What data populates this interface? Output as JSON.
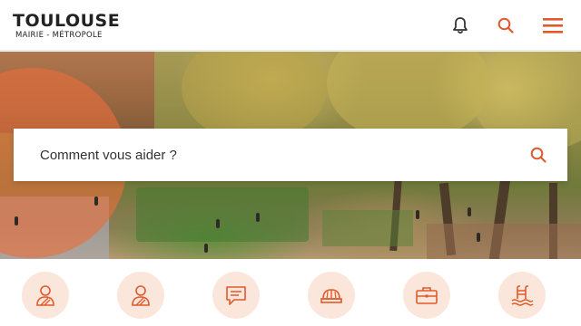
{
  "header": {
    "logo_main": "TOULOUSE",
    "logo_sub": "MAIRIE - MÉTROPOLE",
    "notification_icon": "bell-icon",
    "search_icon": "search-icon",
    "menu_icon": "hamburger-menu-icon"
  },
  "hero": {
    "search": {
      "placeholder": "Comment vous aider ?",
      "button_icon": "search-icon"
    }
  },
  "quick_links": [
    {
      "icon": "person-bust-icon"
    },
    {
      "icon": "person-bust-icon"
    },
    {
      "icon": "message-document-icon"
    },
    {
      "icon": "hard-hat-icon"
    },
    {
      "icon": "briefcase-icon"
    },
    {
      "icon": "swimming-pool-icon"
    }
  ],
  "colors": {
    "accent": "#e05a2b",
    "circle_bg": "#fbe6dc",
    "text": "#222222",
    "hero_overlay": "#e86e3c"
  }
}
